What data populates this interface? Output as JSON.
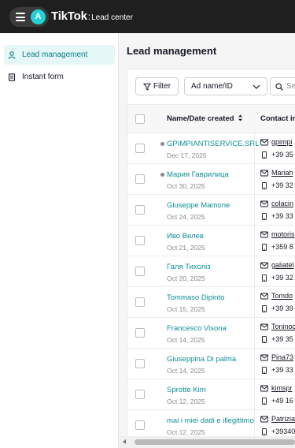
{
  "header": {
    "avatar_letter": "A",
    "brand": "TikTok",
    "brand_sep": ":",
    "product": "Lead center"
  },
  "sidebar": {
    "items": [
      {
        "label": "Lead management",
        "icon": "user-icon",
        "active": true
      },
      {
        "label": "Instant form",
        "icon": "form-icon",
        "active": false
      }
    ]
  },
  "main": {
    "title": "Lead management",
    "filter_label": "Filter",
    "select_value": "Ad name/ID",
    "search_placeholder": "Se"
  },
  "table": {
    "columns": {
      "name": "Name/Date created",
      "contact": "Contact in"
    },
    "rows": [
      {
        "name": "GPIMPIANTISERVICE.SRL",
        "date": "Dec 17, 2025",
        "unread": true,
        "email": "gpimpi",
        "phone": "+39 35"
      },
      {
        "name": "Мария Гаврилица",
        "date": "Oct 30, 2025",
        "unread": true,
        "email": "Mariah",
        "phone": "+39 32"
      },
      {
        "name": "Giuseppe Mamone",
        "date": "Oct 24, 2025",
        "unread": false,
        "email": "colacin",
        "phone": "+39 33"
      },
      {
        "name": "Иво Велев",
        "date": "Oct 21, 2025",
        "unread": false,
        "email": "motoris",
        "phone": "+359 8"
      },
      {
        "name": "Галя Тихоліз",
        "date": "Oct 20, 2025",
        "unread": false,
        "email": "galiatel",
        "phone": "+39 32"
      },
      {
        "name": "Tommaso Dipinto",
        "date": "Oct 15, 2025",
        "unread": false,
        "email": "Tomdo",
        "phone": "+39 39"
      },
      {
        "name": "Francesco Visona",
        "date": "Oct 14, 2025",
        "unread": false,
        "email": "Toninoc",
        "phone": "+39 35"
      },
      {
        "name": "Giuseppina Di palma",
        "date": "Oct 14, 2025",
        "unread": false,
        "email": "Pina73",
        "phone": "+39 33"
      },
      {
        "name": "Sprotte Kim",
        "date": "Oct 12, 2025",
        "unread": false,
        "email": "kimspr",
        "phone": "+49 16"
      },
      {
        "name": "mai i miei dadi e illegittimo",
        "date": "Oct 12, 2025",
        "unread": false,
        "email": "Patrizia",
        "phone": "+39340"
      }
    ]
  },
  "colors": {
    "accent": "#0e8f96",
    "topbar": "#1f1f1f",
    "avatar": "#25d1d7",
    "active_bg": "#e6f7f7"
  }
}
